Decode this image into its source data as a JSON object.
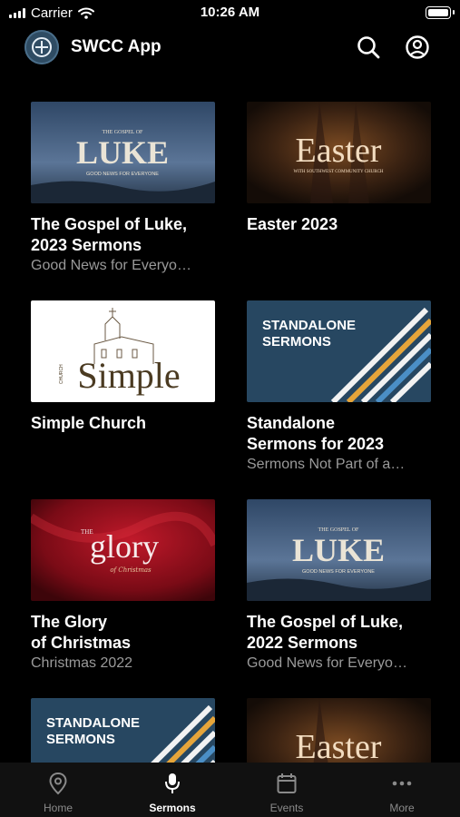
{
  "status_bar": {
    "carrier": "Carrier",
    "time": "10:26 AM"
  },
  "app": {
    "title": "SWCC App"
  },
  "cards": [
    {
      "title": "The Gospel of Luke,\n2023 Sermons",
      "subtitle": "Good News for Everyo…",
      "thumb": {
        "kind": "luke",
        "small": "THE GOSPEL OF",
        "big": "LUKE",
        "tagline": "GOOD NEWS FOR EVERYONE"
      }
    },
    {
      "title": "Easter 2023",
      "subtitle": "",
      "thumb": {
        "kind": "easter",
        "big": "Easter",
        "tagline": "WITH SOUTHWEST COMMUNITY CHURCH"
      }
    },
    {
      "title": "Simple Church",
      "subtitle": "",
      "thumb": {
        "kind": "simple",
        "big": "Simple",
        "side": "CHURCH"
      }
    },
    {
      "title": "Standalone\nSermons for 2023",
      "subtitle": "Sermons Not Part of a…",
      "thumb": {
        "kind": "standalone",
        "line1": "STANDALONE",
        "line2": "SERMONS"
      }
    },
    {
      "title": "The Glory\nof Christmas",
      "subtitle": "Christmas 2022",
      "thumb": {
        "kind": "glory",
        "small": "THE",
        "big": "glory",
        "script": "of Christmas"
      }
    },
    {
      "title": "The Gospel of Luke,\n2022 Sermons",
      "subtitle": "Good News for Everyo…",
      "thumb": {
        "kind": "luke",
        "small": "THE GOSPEL OF",
        "big": "LUKE",
        "tagline": "GOOD NEWS FOR EVERYONE"
      }
    },
    {
      "title": "",
      "subtitle": "",
      "thumb": {
        "kind": "standalone",
        "line1": "STANDALONE",
        "line2": "SERMONS"
      }
    },
    {
      "title": "",
      "subtitle": "",
      "thumb": {
        "kind": "easter",
        "big": "Easter",
        "tagline": ""
      }
    }
  ],
  "tabs": [
    {
      "label": "Home",
      "icon": "location-pin-icon",
      "active": false
    },
    {
      "label": "Sermons",
      "icon": "microphone-icon",
      "active": true
    },
    {
      "label": "Events",
      "icon": "calendar-icon",
      "active": false
    },
    {
      "label": "More",
      "icon": "more-dots-icon",
      "active": false
    }
  ],
  "colors": {
    "background": "#000000",
    "tab_inactive": "#8a8a8a",
    "subtitle": "#9a9a9a"
  }
}
